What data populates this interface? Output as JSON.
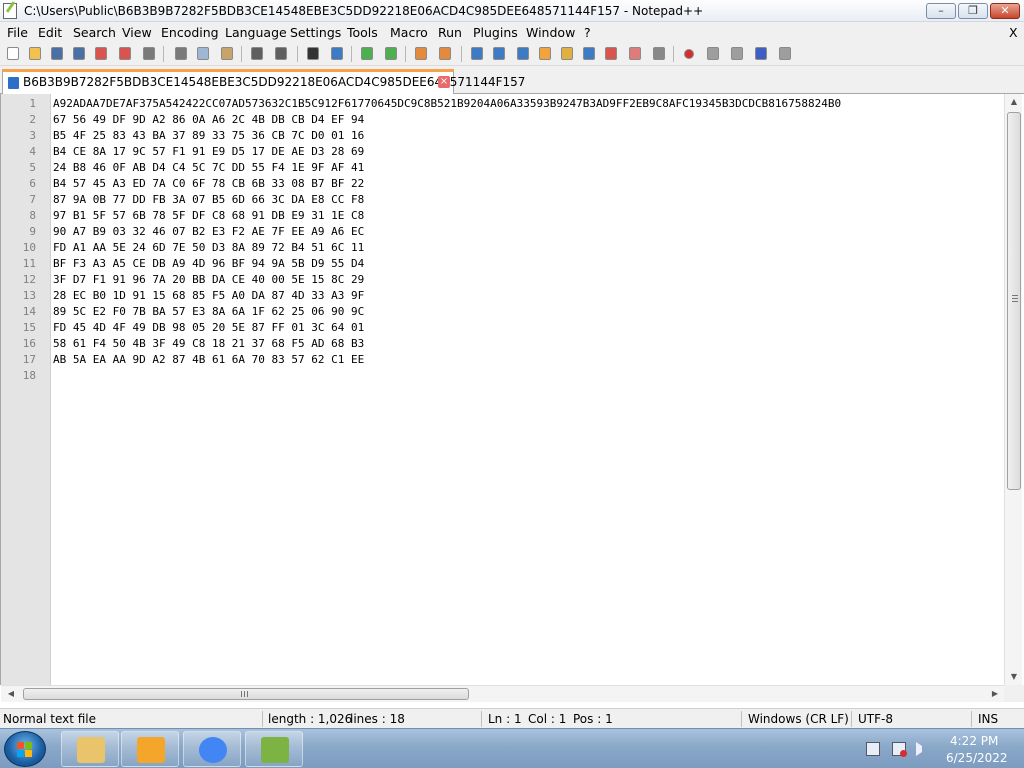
{
  "window": {
    "title": "C:\\Users\\Public\\B6B3B9B7282F5BDB3CE14548EBE3C5DD92218E06ACD4C985DEE648571144F157 - Notepad++",
    "minimize_glyph": "–",
    "maximize_glyph": "❐",
    "close_glyph": "✕"
  },
  "menu": {
    "items": [
      "File",
      "Edit",
      "Search",
      "View",
      "Encoding",
      "Language",
      "Settings",
      "Tools",
      "Macro",
      "Run",
      "Plugins",
      "Window",
      "?"
    ],
    "close_label": "X"
  },
  "toolbar": {
    "buttons": [
      {
        "name": "new-file-icon",
        "color": "#ffffff"
      },
      {
        "name": "open-file-icon",
        "color": "#f2c14e"
      },
      {
        "name": "save-icon",
        "color": "#4a6fa5"
      },
      {
        "name": "save-all-icon",
        "color": "#4a6fa5"
      },
      {
        "name": "close-file-icon",
        "color": "#d9534f"
      },
      {
        "name": "close-all-icon",
        "color": "#d9534f"
      },
      {
        "name": "print-icon",
        "color": "#7a7a7a"
      },
      {
        "name": "cut-icon",
        "color": "#7a7a7a"
      },
      {
        "name": "copy-icon",
        "color": "#9fb6d4"
      },
      {
        "name": "paste-icon",
        "color": "#c9a46a"
      },
      {
        "name": "undo-icon",
        "color": "#5f5f5f"
      },
      {
        "name": "redo-icon",
        "color": "#5f5f5f"
      },
      {
        "name": "find-icon",
        "color": "#333333"
      },
      {
        "name": "replace-icon",
        "color": "#3d7bc4"
      },
      {
        "name": "zoom-in-icon",
        "color": "#4caf50"
      },
      {
        "name": "zoom-out-icon",
        "color": "#4caf50"
      },
      {
        "name": "sync-vertical-icon",
        "color": "#e48a3c"
      },
      {
        "name": "sync-horizontal-icon",
        "color": "#e48a3c"
      },
      {
        "name": "word-wrap-icon",
        "color": "#3d7bc4"
      },
      {
        "name": "show-all-chars-icon",
        "color": "#3d7bc4"
      },
      {
        "name": "indent-guide-icon",
        "color": "#3d7bc4"
      },
      {
        "name": "udl-icon",
        "color": "#f2a33c"
      },
      {
        "name": "doc-map-icon",
        "color": "#e0b040"
      },
      {
        "name": "function-list-icon",
        "color": "#3d7bc4"
      },
      {
        "name": "folder-workspace-icon",
        "color": "#d9534f"
      },
      {
        "name": "doc-switcher-icon",
        "color": "#e07b7b"
      },
      {
        "name": "monitoring-icon",
        "color": "#888888"
      },
      {
        "name": "record-macro-icon",
        "color": "#d32f2f"
      },
      {
        "name": "stop-macro-icon",
        "color": "#9e9e9e"
      },
      {
        "name": "play-macro-icon",
        "color": "#9e9e9e"
      },
      {
        "name": "run-macro-multiple-icon",
        "color": "#3d5fc4"
      },
      {
        "name": "save-macro-icon",
        "color": "#9e9e9e"
      }
    ]
  },
  "tab": {
    "label": "B6B3B9B7282F5BDB3CE14548EBE3C5DD92218E06ACD4C985DEE648571144F157",
    "close_glyph": "×"
  },
  "editor": {
    "line_numbers": [
      "1",
      "2",
      "3",
      "4",
      "5",
      "6",
      "7",
      "8",
      "9",
      "10",
      "11",
      "12",
      "13",
      "14",
      "15",
      "16",
      "17",
      "18"
    ],
    "lines": [
      "A92ADAA7DE7AF375A542422CC07AD573632C1B5C912F61770645DC9C8B521B9204A06A33593B9247B3AD9FF2EB9C8AFC19345B3DCDCB816758824B0",
      "67 56 49 DF 9D A2 86 0A A6 2C 4B DB CB D4 EF 94",
      "B5 4F 25 83 43 BA 37 89 33 75 36 CB 7C D0 01 16",
      "B4 CE 8A 17 9C 57 F1 91 E9 D5 17 DE AE D3 28 69",
      "24 B8 46 0F AB D4 C4 5C 7C DD 55 F4 1E 9F AF 41",
      "B4 57 45 A3 ED 7A C0 6F 78 CB 6B 33 08 B7 BF 22",
      "87 9A 0B 77 DD FB 3A 07 B5 6D 66 3C DA E8 CC F8",
      "97 B1 5F 57 6B 78 5F DF C8 68 91 DB E9 31 1E C8",
      "90 A7 B9 03 32 46 07 B2 E3 F2 AE 7F EE A9 A6 EC",
      "FD A1 AA 5E 24 6D 7E 50 D3 8A 89 72 B4 51 6C 11",
      "BF F3 A3 A5 CE DB A9 4D 96 BF 94 9A 5B D9 55 D4",
      "3F D7 F1 91 96 7A 20 BB DA CE 40 00 5E 15 8C 29",
      "28 EC B0 1D 91 15 68 85 F5 A0 DA 87 4D 33 A3 9F",
      "89 5C E2 F0 7B BA 57 E3 8A 6A 1F 62 25 06 90 9C",
      "FD 45 4D 4F 49 DB 98 05 20 5E 87 FF 01 3C 64 01",
      "58 61 F4 50 4B 3F 49 C8 18 21 37 68 F5 AD 68 B3",
      "AB 5A EA AA 9D A2 87 4B 61 6A 70 83 57 62 C1 EE",
      ""
    ]
  },
  "scrollbars": {
    "up_glyph": "▲",
    "down_glyph": "▼",
    "left_glyph": "◀",
    "right_glyph": "▶"
  },
  "status": {
    "file_type": "Normal text file",
    "length": "length : 1,026",
    "lines": "lines : 18",
    "ln": "Ln : 1",
    "col": "Col : 1",
    "pos": "Pos : 1",
    "eol": "Windows (CR LF)",
    "encoding": "UTF-8",
    "mode": "INS"
  },
  "taskbar": {
    "apps": [
      {
        "name": "explorer-icon",
        "color": "#e9c46a"
      },
      {
        "name": "media-player-icon",
        "color": "#f4a62a"
      },
      {
        "name": "chrome-icon",
        "color": "#4285f4"
      },
      {
        "name": "notepadpp-icon",
        "color": "#7cb342"
      }
    ],
    "clock_time": "4:22 PM",
    "clock_date": "6/25/2022"
  }
}
